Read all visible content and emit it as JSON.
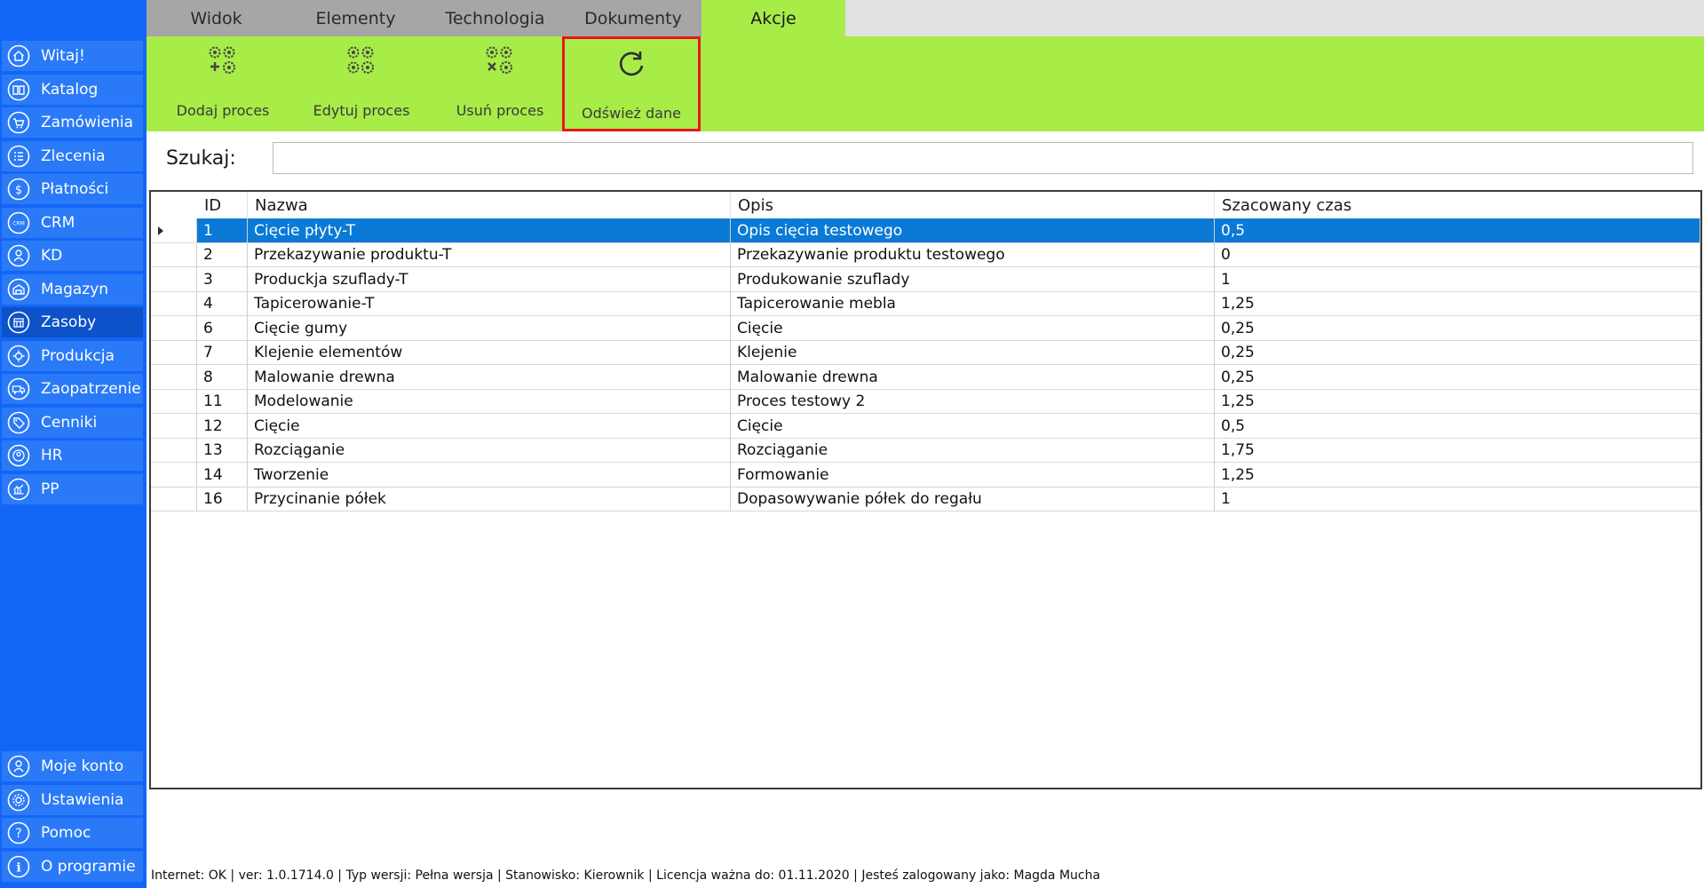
{
  "sidebar": {
    "items": [
      {
        "label": "Witaj!",
        "icon": "home-icon"
      },
      {
        "label": "Katalog",
        "icon": "book-icon"
      },
      {
        "label": "Zamówienia",
        "icon": "cart-icon"
      },
      {
        "label": "Zlecenia",
        "icon": "list-icon"
      },
      {
        "label": "Płatności",
        "icon": "dollar-icon"
      },
      {
        "label": "CRM",
        "icon": "crm-icon"
      },
      {
        "label": "KD",
        "icon": "person-icon"
      },
      {
        "label": "Magazyn",
        "icon": "warehouse-icon"
      },
      {
        "label": "Zasoby",
        "icon": "resources-icon"
      },
      {
        "label": "Produkcja",
        "icon": "production-icon"
      },
      {
        "label": "Zaopatrzenie",
        "icon": "truck-icon"
      },
      {
        "label": "Cenniki",
        "icon": "tag-icon"
      },
      {
        "label": "HR",
        "icon": "hr-icon"
      },
      {
        "label": "PP",
        "icon": "chart-icon"
      }
    ],
    "active": "Zasoby",
    "bottom_items": [
      {
        "label": "Moje konto",
        "icon": "account-icon"
      },
      {
        "label": "Ustawienia",
        "icon": "gear-icon"
      },
      {
        "label": "Pomoc",
        "icon": "help-icon"
      },
      {
        "label": "O programie",
        "icon": "info-icon"
      }
    ]
  },
  "tabs": [
    "Widok",
    "Elementy",
    "Technologia",
    "Dokumenty",
    "Akcje"
  ],
  "active_tab": "Akcje",
  "ribbon": {
    "buttons": [
      {
        "label": "Dodaj proces",
        "icon": "gears-add-icon"
      },
      {
        "label": "Edytuj proces",
        "icon": "gears-edit-icon"
      },
      {
        "label": "Usuń proces",
        "icon": "gears-delete-icon"
      },
      {
        "label": "Odśwież dane",
        "icon": "refresh-icon"
      }
    ],
    "highlighted": "Odśwież dane"
  },
  "search": {
    "label": "Szukaj:",
    "value": ""
  },
  "grid": {
    "columns": [
      "ID",
      "Nazwa",
      "Opis",
      "Szacowany czas"
    ],
    "selected_row": 0,
    "rows": [
      [
        "1",
        "Cięcie płyty-T",
        "Opis cięcia testowego",
        "0,5"
      ],
      [
        "2",
        "Przekazywanie produktu-T",
        "Przekazywanie produktu testowego",
        "0"
      ],
      [
        "3",
        "Produckja szuflady-T",
        "Produkowanie szuflady",
        "1"
      ],
      [
        "4",
        "Tapicerowanie-T",
        "Tapicerowanie mebla",
        "1,25"
      ],
      [
        "6",
        "Cięcie gumy",
        "Cięcie",
        "0,25"
      ],
      [
        "7",
        "Klejenie elementów",
        "Klejenie",
        "0,25"
      ],
      [
        "8",
        "Malowanie drewna",
        "Malowanie drewna",
        "0,25"
      ],
      [
        "11",
        "Modelowanie",
        "Proces testowy 2",
        "1,25"
      ],
      [
        "12",
        "Cięcie",
        "Cięcie",
        "0,5"
      ],
      [
        "13",
        "Rozciąganie",
        "Rozciąganie",
        "1,75"
      ],
      [
        "14",
        "Tworzenie",
        "Formowanie",
        "1,25"
      ],
      [
        "16",
        "Przycinanie półek",
        "Dopasowywanie półek do regału",
        "1"
      ]
    ]
  },
  "statusbar": {
    "text": "Internet: OK  |   ver: 1.0.1714.0   |   Typ wersji: Pełna wersja   |   Stanowisko: Kierownik   |   Licencja ważna do: 01.11.2020   |   Jesteś zalogowany jako: Magda Mucha"
  },
  "colors": {
    "sidebar": "#1366f5",
    "ribbon": "#a8ec48",
    "selection": "#0a7ad6",
    "highlight_border": "#e8161b"
  }
}
